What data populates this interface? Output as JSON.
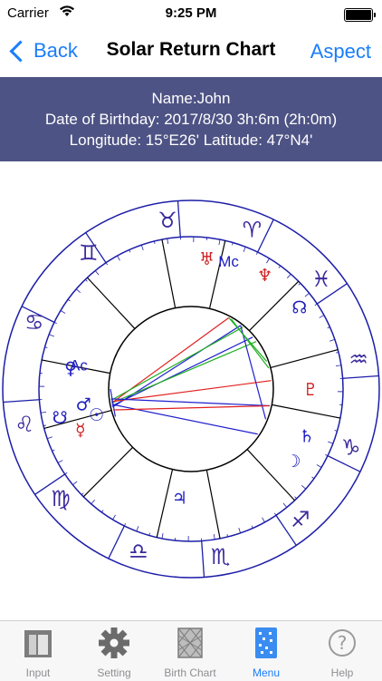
{
  "status": {
    "carrier": "Carrier",
    "time": "9:25 PM"
  },
  "nav": {
    "back_label": "Back",
    "title": "Solar Return Chart",
    "right_label": "Aspect"
  },
  "info": {
    "name_line": "Name:John",
    "birth_line": "Date of Birthday: 2017/8/30 3h:6m (2h:0m)",
    "location_line": "Longitude: 15°E26' Latitude: 47°N4'"
  },
  "chart": {
    "zodiac_signs": [
      "♈",
      "♉",
      "♊",
      "♋",
      "♌",
      "♍",
      "♎",
      "♏",
      "♐",
      "♑",
      "♒",
      "♓"
    ],
    "zodiac_color": "#3a2a9c",
    "line_colors": {
      "red": "#e02020",
      "blue": "#2020d0",
      "green": "#20b020",
      "frame": "#1d1ea8",
      "house": "#000000"
    },
    "labels": {
      "ascendant": "Ac",
      "midheaven": "Mc"
    },
    "planets": [
      {
        "name": "uranus",
        "glyph": "♅",
        "color": "#d02020"
      },
      {
        "name": "neptune",
        "glyph": "♆",
        "color": "#d02020"
      },
      {
        "name": "north-node",
        "glyph": "☊",
        "color": "#2020c0"
      },
      {
        "name": "pluto",
        "glyph": "♇",
        "color": "#d02020"
      },
      {
        "name": "saturn",
        "glyph": "♄",
        "color": "#2020c0"
      },
      {
        "name": "moon",
        "glyph": "☽",
        "color": "#2020c0"
      },
      {
        "name": "jupiter",
        "glyph": "♃",
        "color": "#2020c0"
      },
      {
        "name": "venus",
        "glyph": "♀",
        "color": "#2020c0"
      },
      {
        "name": "mars",
        "glyph": "♂",
        "color": "#2020c0"
      },
      {
        "name": "sun",
        "glyph": "☉",
        "color": "#2020c0"
      },
      {
        "name": "mercury",
        "glyph": "☿",
        "color": "#d02020"
      },
      {
        "name": "south-node",
        "glyph": "☋",
        "color": "#2020c0"
      }
    ]
  },
  "tabs": [
    {
      "label": "Input",
      "icon": "input-icon"
    },
    {
      "label": "Setting",
      "icon": "gear-icon"
    },
    {
      "label": "Birth Chart",
      "icon": "birth-chart-icon"
    },
    {
      "label": "Menu",
      "icon": "menu-icon",
      "active": true
    },
    {
      "label": "Help",
      "icon": "help-icon"
    }
  ]
}
